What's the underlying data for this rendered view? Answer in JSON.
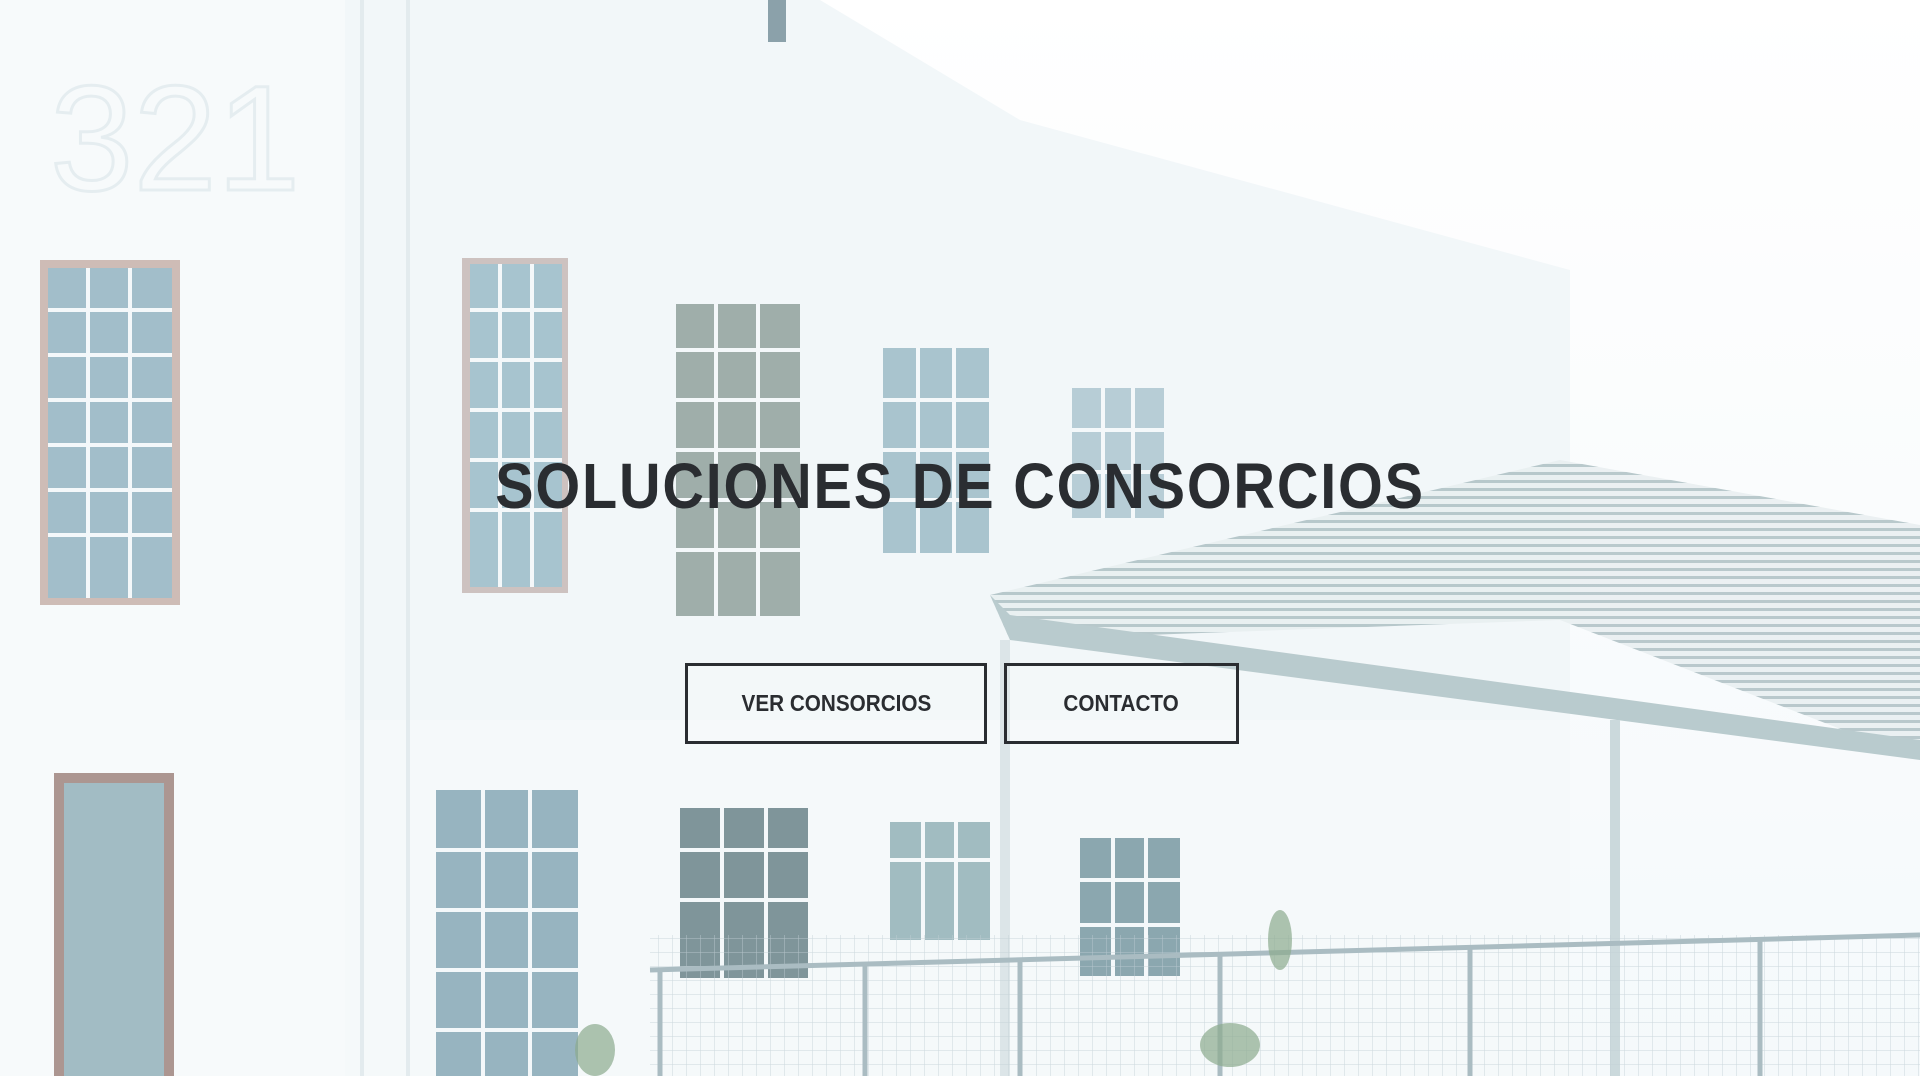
{
  "hero": {
    "title": "SOLUCIONES DE CONSORCIOS",
    "buttons": {
      "ver_consorcios": "VER CONSORCIOS",
      "contacto": "CONTACTO"
    },
    "background_image": "washed-out-industrial-building-photo",
    "building_number": "321"
  },
  "colors": {
    "text": "#2a2d31",
    "background": "#f7fbfd",
    "glass": "#6c99ad"
  }
}
